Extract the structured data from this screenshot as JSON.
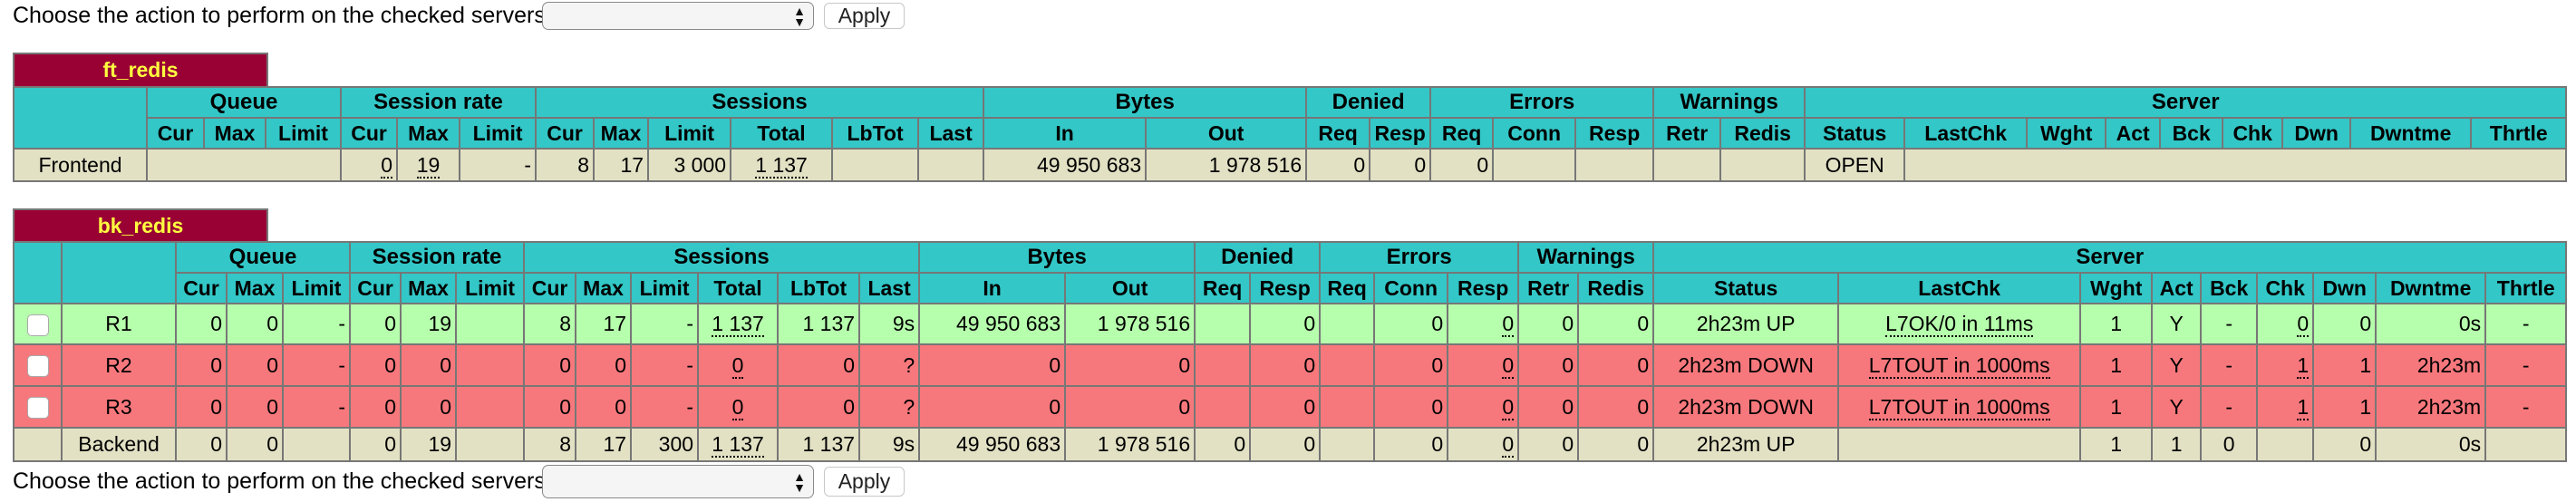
{
  "action_bar": {
    "label": "Choose the action to perform on the checked servers :",
    "select_value": "",
    "apply_label": "Apply"
  },
  "frontend_proxy": {
    "name": "ft_redis",
    "group_headers": [
      "Queue",
      "Session rate",
      "Sessions",
      "Bytes",
      "Denied",
      "Errors",
      "Warnings",
      "Server"
    ],
    "sub_headers": [
      "Cur",
      "Max",
      "Limit",
      "Cur",
      "Max",
      "Limit",
      "Cur",
      "Max",
      "Limit",
      "Total",
      "LbTot",
      "Last",
      "In",
      "Out",
      "Req",
      "Resp",
      "Req",
      "Conn",
      "Resp",
      "Retr",
      "Redis",
      "Status",
      "LastChk",
      "Wght",
      "Act",
      "Bck",
      "Chk",
      "Dwn",
      "Dwntme",
      "Thrtle"
    ],
    "row": {
      "name": "Frontend",
      "session_rate": {
        "cur": "0",
        "max": "19",
        "limit": "-"
      },
      "sessions": {
        "cur": "8",
        "max": "17",
        "limit": "3 000",
        "total": "1 137"
      },
      "bytes": {
        "in": "49 950 683",
        "out": "1 978 516"
      },
      "denied": {
        "req": "0",
        "resp": "0"
      },
      "errors": {
        "req": "0"
      },
      "status": "OPEN"
    }
  },
  "backend_proxy": {
    "name": "bk_redis",
    "rows": [
      {
        "name": "R1",
        "state": "up",
        "q_cur": "0",
        "q_max": "0",
        "q_limit": "-",
        "sr_cur": "0",
        "sr_max": "19",
        "sr_limit": "",
        "s_cur": "8",
        "s_max": "17",
        "s_limit": "-",
        "s_total": "1 137",
        "s_lbtot": "1 137",
        "s_last": "9s",
        "b_in": "49 950 683",
        "b_out": "1 978 516",
        "d_req": "",
        "d_resp": "0",
        "e_req": "",
        "e_conn": "0",
        "e_resp": "0",
        "w_retr": "0",
        "w_redis": "0",
        "status": "2h23m UP",
        "lastchk": "L7OK/0 in 11ms",
        "wght": "1",
        "act": "Y",
        "bck": "-",
        "chk": "0",
        "dwn": "0",
        "dwntme": "0s",
        "thrtle": "-"
      },
      {
        "name": "R2",
        "state": "down",
        "q_cur": "0",
        "q_max": "0",
        "q_limit": "-",
        "sr_cur": "0",
        "sr_max": "0",
        "sr_limit": "",
        "s_cur": "0",
        "s_max": "0",
        "s_limit": "-",
        "s_total": "0",
        "s_lbtot": "0",
        "s_last": "?",
        "b_in": "0",
        "b_out": "0",
        "d_req": "",
        "d_resp": "0",
        "e_req": "",
        "e_conn": "0",
        "e_resp": "0",
        "w_retr": "0",
        "w_redis": "0",
        "status": "2h23m DOWN",
        "lastchk": "L7TOUT in 1000ms",
        "wght": "1",
        "act": "Y",
        "bck": "-",
        "chk": "1",
        "dwn": "1",
        "dwntme": "2h23m",
        "thrtle": "-"
      },
      {
        "name": "R3",
        "state": "down",
        "q_cur": "0",
        "q_max": "0",
        "q_limit": "-",
        "sr_cur": "0",
        "sr_max": "0",
        "sr_limit": "",
        "s_cur": "0",
        "s_max": "0",
        "s_limit": "-",
        "s_total": "0",
        "s_lbtot": "0",
        "s_last": "?",
        "b_in": "0",
        "b_out": "0",
        "d_req": "",
        "d_resp": "0",
        "e_req": "",
        "e_conn": "0",
        "e_resp": "0",
        "w_retr": "0",
        "w_redis": "0",
        "status": "2h23m DOWN",
        "lastchk": "L7TOUT in 1000ms",
        "wght": "1",
        "act": "Y",
        "bck": "-",
        "chk": "1",
        "dwn": "1",
        "dwntme": "2h23m",
        "thrtle": "-"
      }
    ],
    "backend_row": {
      "name": "Backend",
      "q_cur": "0",
      "q_max": "0",
      "q_limit": "",
      "sr_cur": "0",
      "sr_max": "19",
      "sr_limit": "",
      "s_cur": "8",
      "s_max": "17",
      "s_limit": "300",
      "s_total": "1 137",
      "s_lbtot": "1 137",
      "s_last": "9s",
      "b_in": "49 950 683",
      "b_out": "1 978 516",
      "d_req": "0",
      "d_resp": "0",
      "e_req": "",
      "e_conn": "0",
      "e_resp": "0",
      "w_retr": "0",
      "w_redis": "0",
      "status": "2h23m UP",
      "lastchk": "",
      "wght": "1",
      "act": "1",
      "bck": "0",
      "chk": "",
      "dwn": "0",
      "dwntme": "0s",
      "thrtle": ""
    }
  },
  "colors": {
    "proxy_name_bg": "#990033",
    "proxy_name_text": "#ffff40",
    "header_bg": "#33c7c7",
    "frontend_backend_bg": "#e2e1c4",
    "server_up_bg": "#b6ffac",
    "server_down_bg": "#f7787c"
  }
}
